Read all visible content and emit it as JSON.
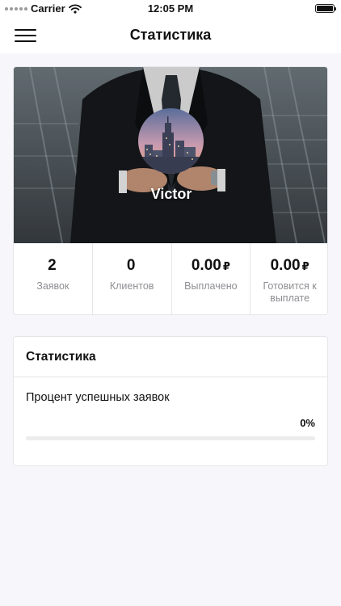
{
  "status_bar": {
    "carrier": "Carrier",
    "time": "12:05 PM",
    "icons": [
      "signal-dots-icon",
      "wifi-icon",
      "battery-icon"
    ]
  },
  "nav": {
    "title": "Статистика",
    "menu_icon": "hamburger-menu-icon"
  },
  "profile": {
    "name": "Victor",
    "avatar_icon": "city-skyline-avatar",
    "stats": [
      {
        "value": "2",
        "currency": "",
        "label": "Заявок"
      },
      {
        "value": "0",
        "currency": "",
        "label": "Клиентов"
      },
      {
        "value": "0.00",
        "currency": "₽",
        "label": "Выплачено"
      },
      {
        "value": "0.00",
        "currency": "₽",
        "label": "Готовится к выплате"
      }
    ]
  },
  "statistics": {
    "title": "Статистика",
    "metric_label": "Процент успешных заявок",
    "metric_value": "0%",
    "progress_percent": 0
  },
  "colors": {
    "background": "#f7f6fa",
    "card": "#ffffff",
    "accent_text": "#111111",
    "muted_text": "#8e8e93"
  }
}
